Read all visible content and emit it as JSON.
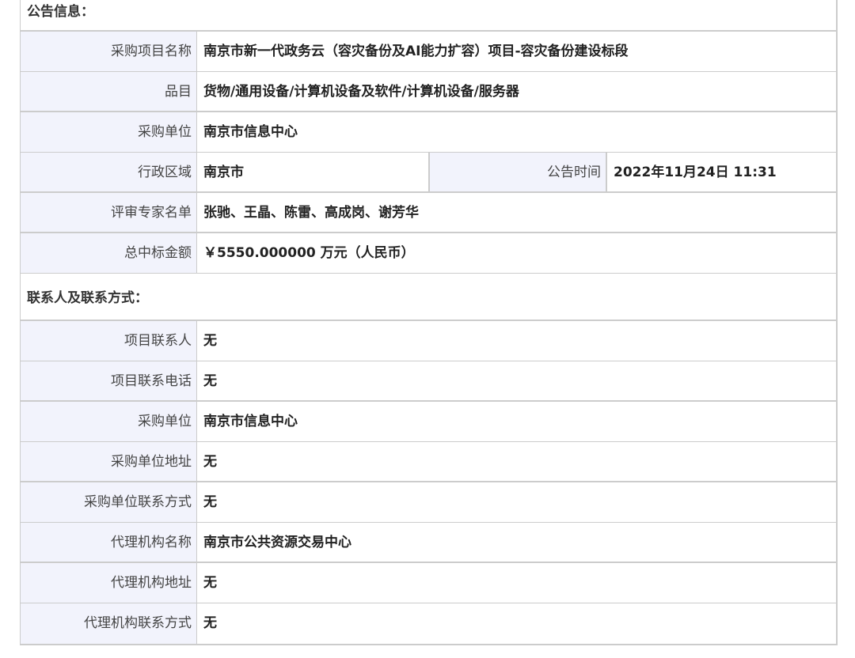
{
  "notice_section": {
    "title": "公告信息：",
    "project_name": {
      "label": "采购项目名称",
      "value": "南京市新一代政务云（容灾备份及AI能力扩容）项目-容灾备份建设标段"
    },
    "category": {
      "label": "品目",
      "value": "货物/通用设备/计算机设备及软件/计算机设备/服务器"
    },
    "purchaser": {
      "label": "采购单位",
      "value": "南京市信息中心"
    },
    "region": {
      "label": "行政区域",
      "value": "南京市"
    },
    "announce_time": {
      "label": "公告时间",
      "value": "2022年11月24日 11:31"
    },
    "experts": {
      "label": "评审专家名单",
      "value": "张驰、王晶、陈雷、高成岗、谢芳华"
    },
    "amount": {
      "label": "总中标金额",
      "value": "￥5550.000000 万元（人民币）"
    }
  },
  "contact_section": {
    "title": "联系人及联系方式：",
    "rows": [
      {
        "label": "项目联系人",
        "value": "无"
      },
      {
        "label": "项目联系电话",
        "value": "无"
      },
      {
        "label": "采购单位",
        "value": "南京市信息中心"
      },
      {
        "label": "采购单位地址",
        "value": "无"
      },
      {
        "label": "采购单位联系方式",
        "value": "无"
      },
      {
        "label": "代理机构名称",
        "value": "南京市公共资源交易中心"
      },
      {
        "label": "代理机构地址",
        "value": "无"
      },
      {
        "label": "代理机构联系方式",
        "value": "无"
      }
    ]
  }
}
